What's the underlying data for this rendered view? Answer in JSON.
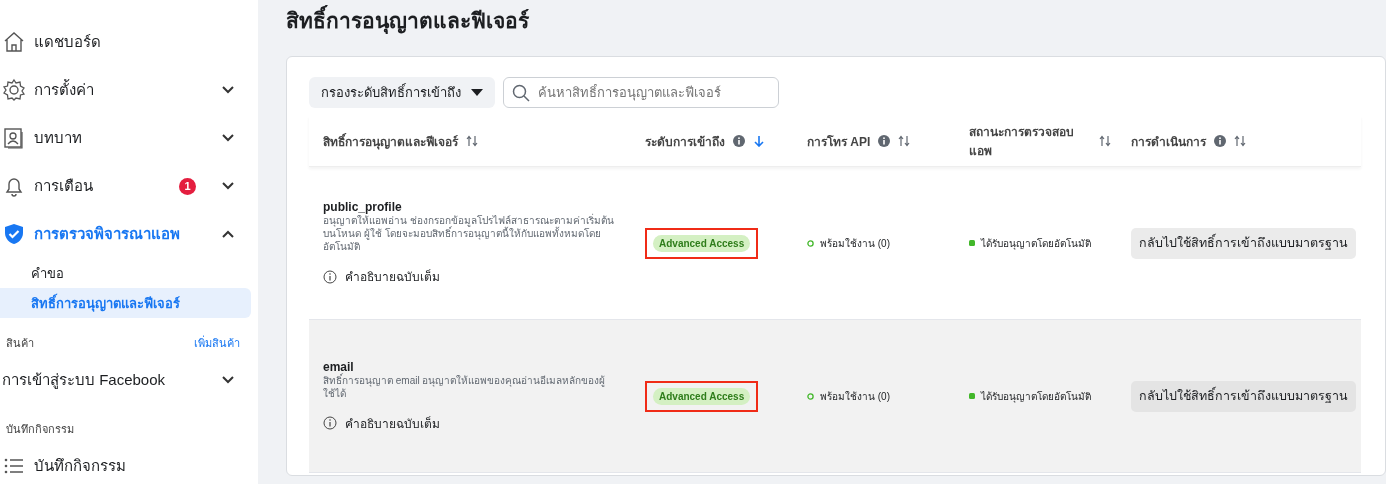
{
  "sidebar": {
    "items": [
      {
        "kind": "main",
        "label": "แดชบอร์ด",
        "selected": false
      },
      {
        "kind": "main",
        "label": "การตั้งค่า",
        "expandable": true,
        "expanded": false,
        "selected": false
      },
      {
        "kind": "main",
        "label": "บทบาท",
        "expandable": true,
        "expanded": false,
        "selected": false
      },
      {
        "kind": "main",
        "label": "การเตือน",
        "badge": "1",
        "expandable": true,
        "expanded": false,
        "selected": false
      },
      {
        "kind": "main",
        "label": "การตรวจพิจารณาแอพ",
        "expandable": true,
        "expanded": true,
        "selected": true
      },
      {
        "kind": "sub",
        "label": "คำขอ",
        "selected": false
      },
      {
        "kind": "sub",
        "label": "สิทธิ์การอนุญาตและฟีเจอร์",
        "selected": true
      },
      {
        "kind": "section",
        "label": "สินค้า",
        "link": "เพิ่มสินค้า"
      },
      {
        "kind": "main",
        "label": "การเข้าสู่ระบบ Facebook",
        "expandable": true,
        "expanded": false,
        "selected": false
      },
      {
        "kind": "section",
        "label": "บันทึกกิจกรรม"
      },
      {
        "kind": "main",
        "label": "บันทึกกิจกรรม",
        "selected": false
      }
    ]
  },
  "page_title": "สิทธิ์การอนุญาตและฟีเจอร์",
  "filter": {
    "label": "กรองระดับสิทธิ์การเข้าถึง"
  },
  "search": {
    "placeholder": "ค้นหาสิทธิ์การอนุญาตและฟีเจอร์"
  },
  "table": {
    "columns": [
      {
        "label": "สิทธิ์การอนุญาตและฟีเจอร์",
        "info": false,
        "sorted": false
      },
      {
        "label": "ระดับการเข้าถึง",
        "info": true,
        "sorted": true
      },
      {
        "label": "การโทร API",
        "info": true,
        "sorted": false
      },
      {
        "label": "สถานะการตรวจสอบแอพ",
        "info": false,
        "sorted": false
      },
      {
        "label": "การดำเนินการ",
        "info": true,
        "sorted": false
      }
    ],
    "rows": [
      {
        "name": "public_profile",
        "description": "อนุญาตให้แอพอ่าน ช่องกรอกข้อมูลโปรไฟล์สาธารณะตามค่าเริ่มต้นบนโหนด ผู้ใช้ โดยจะมอบสิทธิ์การอนุญาตนี้ให้กับแอพทั้งหมดโดยอัตโนมัติ",
        "details_link": "คำอธิบายฉบับเต็ม",
        "access": "Advanced Access",
        "access_highlighted": true,
        "api_calls": "พร้อมใช้งาน (0)",
        "review_status": "ได้รับอนุญาตโดยอัตโนมัติ",
        "action": "กลับไปใช้สิทธิ์การเข้าถึงแบบมาตรฐาน",
        "hovered": false
      },
      {
        "name": "email",
        "description": "สิทธิ์การอนุญาต email อนุญาตให้แอพของคุณอ่านอีเมลหลักของผู้ใช้ได้",
        "details_link": "คำอธิบายฉบับเต็ม",
        "access": "Advanced Access",
        "access_highlighted": true,
        "api_calls": "พร้อมใช้งาน (0)",
        "review_status": "ได้รับอนุญาตโดยอัตโนมัติ",
        "action": "กลับไปใช้สิทธิ์การเข้าถึงแบบมาตรฐาน",
        "hovered": true
      }
    ]
  }
}
